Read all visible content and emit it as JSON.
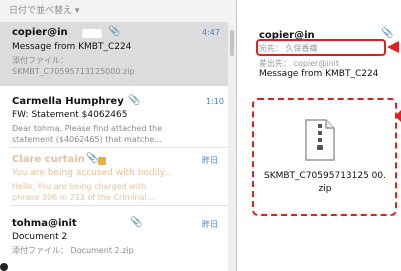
{
  "sort_bar": {
    "label": "日付で並べ替え ▾"
  },
  "messages": [
    {
      "from": "copier@in",
      "time": "4:47",
      "subject": "Message from KMBT_C224",
      "preview1": "添付ファイル：",
      "preview2": "SKMBT_C70595713125000.zip"
    },
    {
      "from": "Carmella Humphrey",
      "time": "1:10",
      "subject": "FW: Statement $4062465",
      "preview1": "Dear tohma, Please find attached the",
      "preview2": "statement ($4062465) that matche..."
    },
    {
      "from": "Clare curtain",
      "time": "昨日",
      "subject": "You are being accused with bodily...",
      "preview1": "Hello, You are being charged with",
      "preview2": "phrase 306 in 213 of the Criminal..."
    },
    {
      "from": "tohma@init",
      "time": "昨日",
      "subject": "Document 2",
      "preview1": "添付ファイル： Document 2.zip"
    }
  ],
  "reading_pane": {
    "from": "copier@in",
    "to": "宛先： 久保香織",
    "cc": "差出先： copier@init",
    "subject": "Message from KMBT_C224",
    "attachment": {
      "name": "SKMBT_C70595713125 00.zip"
    }
  },
  "colors": {
    "accent_time": "#3f7fd6",
    "callout": "#e02020",
    "selected_row": "#dcdcdc"
  }
}
